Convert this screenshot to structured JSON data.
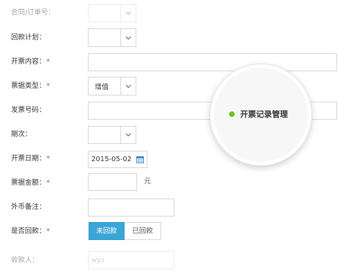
{
  "form": {
    "contract_order_no": {
      "label": "合同/订单号："
    },
    "payment_plan": {
      "label": "回款计划："
    },
    "invoice_content": {
      "label": "开票内容：",
      "required_mark": "*"
    },
    "invoice_type": {
      "label": "票据类型：",
      "required_mark": "*",
      "value": "增值"
    },
    "invoice_number": {
      "label": "发票号码："
    },
    "period": {
      "label": "期次："
    },
    "invoice_date": {
      "label": "开票日期：",
      "required_mark": "*",
      "value": "2015-05-02"
    },
    "invoice_amount": {
      "label": "票据金额：",
      "required_mark": "*",
      "unit": "元"
    },
    "foreign_currency_note": {
      "label": "外币备注："
    },
    "payment_received": {
      "label": "是否回款：",
      "required_mark": "*",
      "options": [
        "未回款",
        "已回款"
      ],
      "selected": "未回款"
    },
    "payee": {
      "label": "收款人：",
      "value": "wyz"
    }
  },
  "callout": {
    "text": "开票记录管理",
    "dot_color": "#6cc21c"
  },
  "colors": {
    "accent": "#3aa6d8",
    "required": "#e0322a",
    "border": "#d4d4d4"
  },
  "icons": [
    "chevron-down-icon",
    "calendar-icon"
  ]
}
